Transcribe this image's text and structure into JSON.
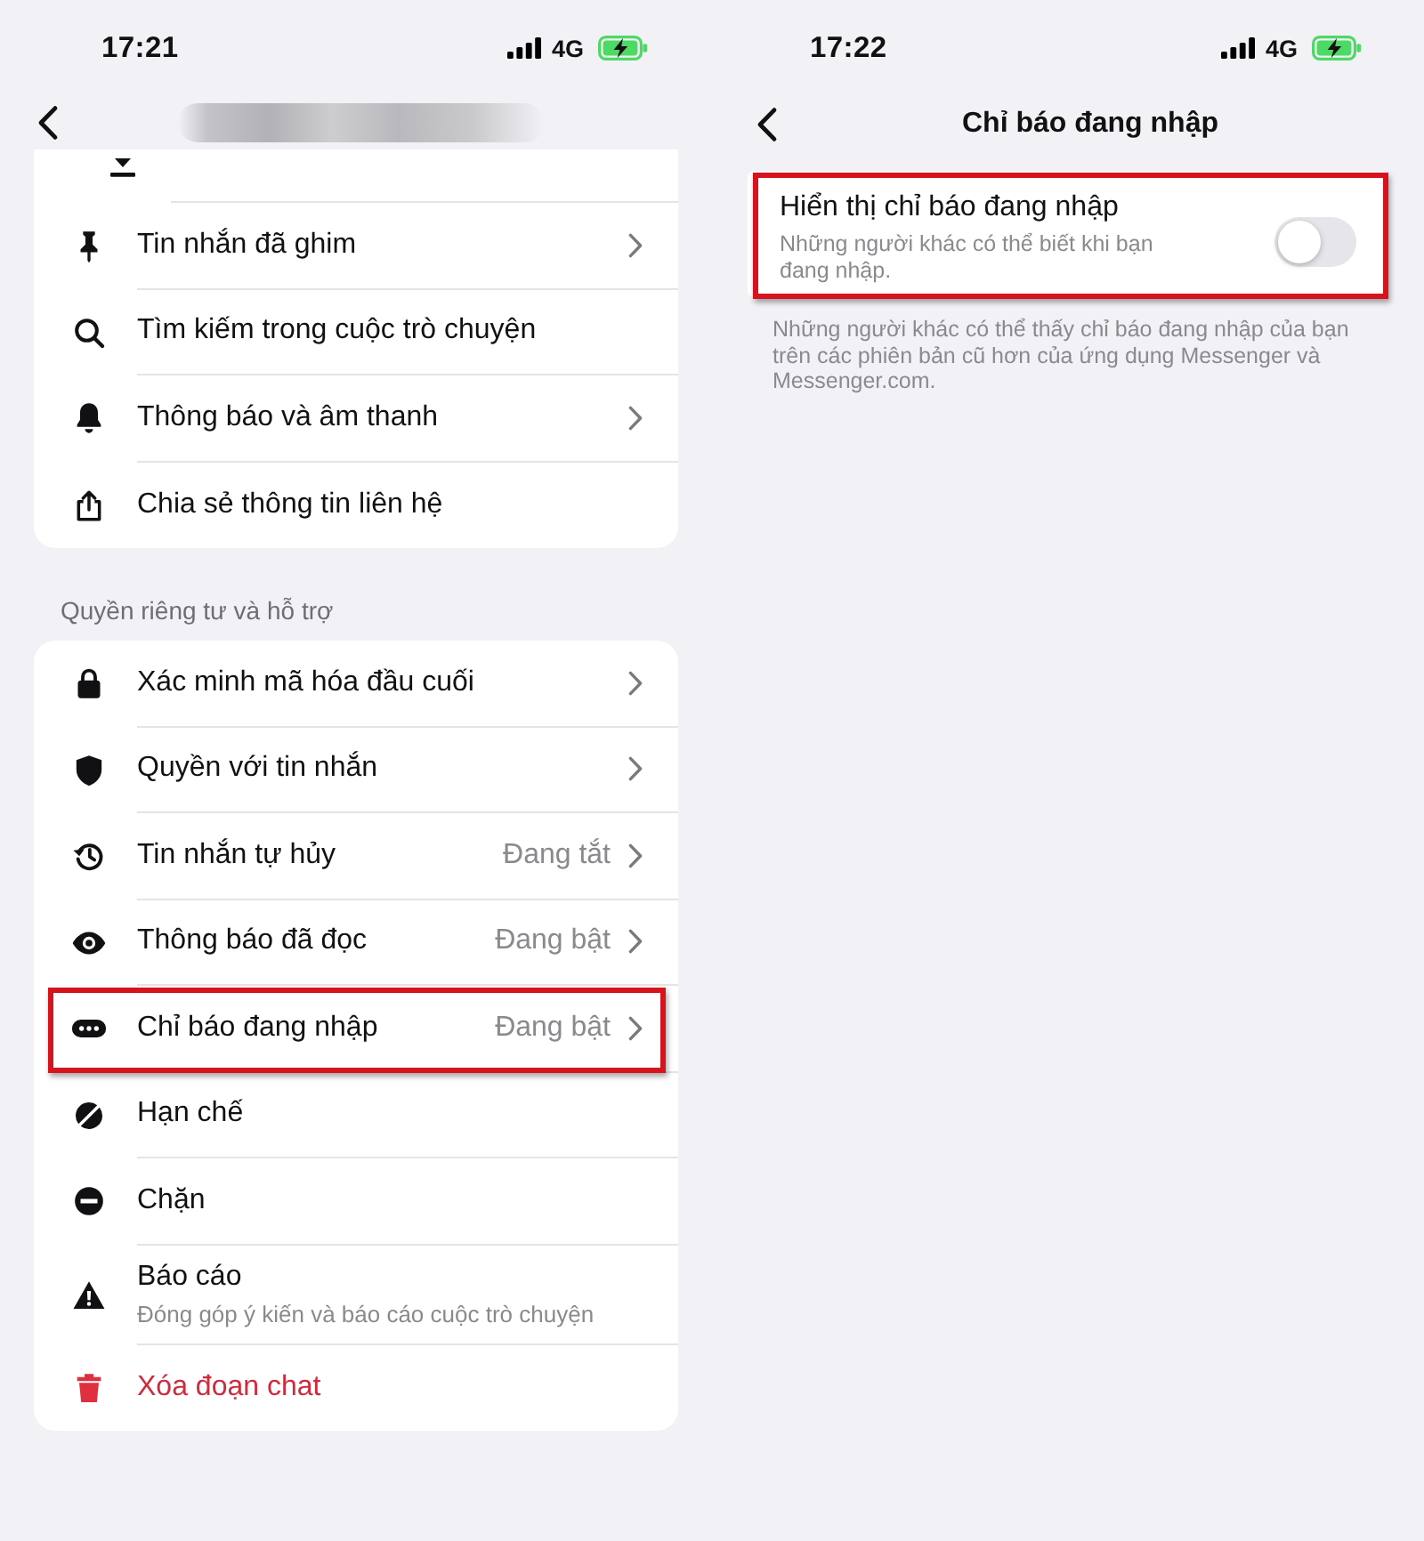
{
  "left_screen": {
    "status_bar": {
      "time": "17:21",
      "network": "4G"
    },
    "sections": [
      {
        "items": [
          {
            "label": "Tin nhắn đã ghim",
            "kind": "normal",
            "chevron": true,
            "highlighted": false
          },
          {
            "label": "Tìm kiếm trong cuộc trò chuyện",
            "kind": "normal",
            "chevron": false,
            "highlighted": false
          },
          {
            "label": "Thông báo và âm thanh",
            "kind": "normal",
            "chevron": true,
            "highlighted": false
          },
          {
            "label": "Chia sẻ thông tin liên hệ",
            "kind": "normal",
            "chevron": false,
            "highlighted": false
          }
        ]
      },
      {
        "title": "Quyền riêng tư và hỗ trợ",
        "items": [
          {
            "label": "Xác minh mã hóa đầu cuối",
            "kind": "normal",
            "chevron": true,
            "highlighted": false
          },
          {
            "label": "Quyền với tin nhắn",
            "kind": "normal",
            "chevron": true,
            "highlighted": false
          },
          {
            "label": "Tin nhắn tự hủy",
            "value": "Đang tắt",
            "kind": "normal",
            "chevron": true,
            "highlighted": false
          },
          {
            "label": "Thông báo đã đọc",
            "value": "Đang bật",
            "kind": "normal",
            "chevron": true,
            "highlighted": false
          },
          {
            "label": "Chỉ báo đang nhập",
            "value": "Đang bật",
            "kind": "normal",
            "chevron": true,
            "highlighted": true
          },
          {
            "label": "Hạn chế",
            "kind": "normal",
            "chevron": false,
            "highlighted": false
          },
          {
            "label": "Chặn",
            "kind": "normal",
            "chevron": false,
            "highlighted": false
          },
          {
            "label": "Báo cáo",
            "description": "Đóng góp ý kiến và báo cáo cuộc trò chuyện",
            "kind": "normal",
            "chevron": false,
            "highlighted": false
          },
          {
            "label": "Xóa đoạn chat",
            "kind": "danger",
            "chevron": false,
            "highlighted": false
          }
        ]
      }
    ]
  },
  "right_screen": {
    "status_bar": {
      "time": "17:22",
      "network": "4G"
    },
    "header": {
      "title": "Chỉ báo đang nhập"
    },
    "setting": {
      "label": "Hiển thị chỉ báo đang nhập",
      "description": "Những người khác có thể biết khi bạn đang nhập.",
      "on": false,
      "highlighted": true
    },
    "footnote": "Những người khác có thể thấy chỉ báo đang nhập của bạn trên các phiên bản cũ hơn của ứng dụng Messenger và Messenger.com."
  }
}
